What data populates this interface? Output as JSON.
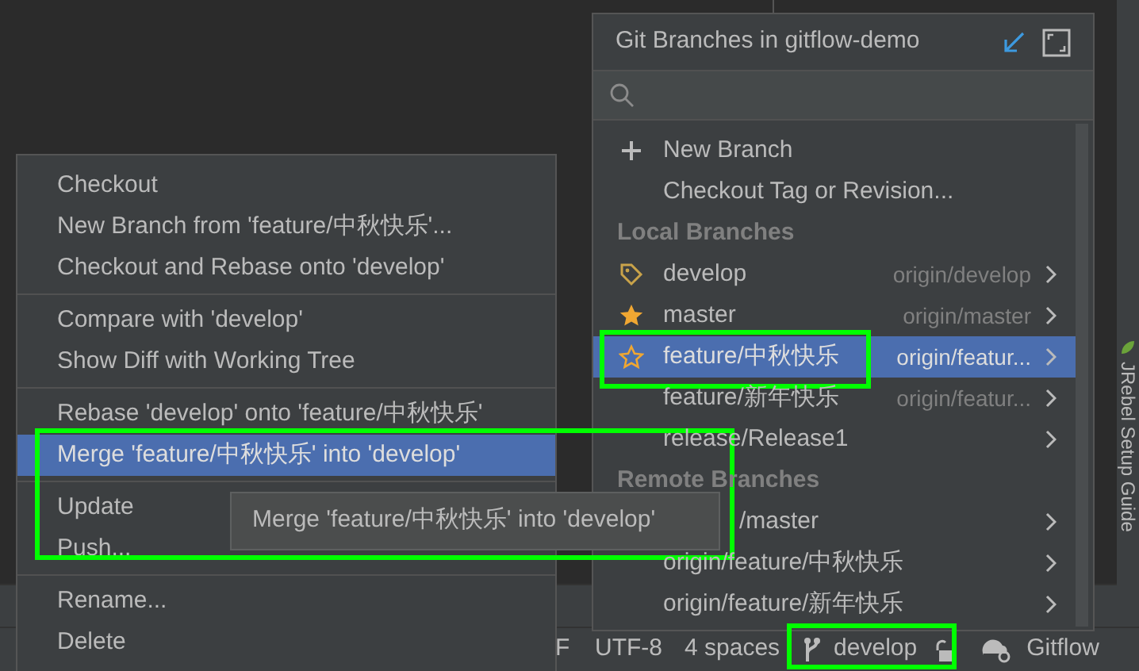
{
  "branches_popup": {
    "title": "Git Branches in gitflow-demo",
    "actions": [
      {
        "kind": "plus",
        "label": "New Branch"
      },
      {
        "kind": "plain",
        "label": "Checkout Tag or Revision..."
      }
    ],
    "local_header": "Local Branches",
    "local": [
      {
        "name": "develop",
        "remote": "origin/develop",
        "kind": "tag",
        "selected": false
      },
      {
        "name": "master",
        "remote": "origin/master",
        "kind": "star",
        "selected": false
      },
      {
        "name": "feature/中秋快乐",
        "remote": "origin/featur...",
        "kind": "star-outline",
        "selected": true
      },
      {
        "name": "feature/新年快乐",
        "remote": "origin/featur...",
        "kind": "plain",
        "selected": false
      },
      {
        "name": "release/Release1",
        "kind": "plain",
        "selected": false
      }
    ],
    "remote_header": "Remote Branches",
    "remote": [
      {
        "name": "/master",
        "partly_covered": true
      },
      {
        "name": "origin/feature/中秋快乐"
      },
      {
        "name": "origin/feature/新年快乐"
      }
    ]
  },
  "context_menu": {
    "groups": [
      [
        {
          "label": "Checkout",
          "selected": false
        },
        {
          "label": "New Branch from 'feature/中秋快乐'...",
          "selected": false
        },
        {
          "label": "Checkout and Rebase onto 'develop'",
          "selected": false
        }
      ],
      [
        {
          "label": "Compare with 'develop'",
          "selected": false
        },
        {
          "label": "Show Diff with Working Tree",
          "selected": false
        }
      ],
      [
        {
          "label": "Rebase 'develop' onto 'feature/中秋快乐'",
          "selected": false
        },
        {
          "label": "Merge 'feature/中秋快乐' into 'develop'",
          "selected": true
        }
      ],
      [
        {
          "label": "Update",
          "selected": false
        },
        {
          "label": "Push...",
          "selected": false
        }
      ],
      [
        {
          "label": "Rename...",
          "selected": false
        },
        {
          "label": "Delete",
          "selected": false
        }
      ]
    ]
  },
  "tooltip": "Merge 'feature/中秋快乐' into 'develop'",
  "side_tab": "JRebel Setup Guide",
  "status_bar": {
    "line_separator": "F",
    "encoding": "UTF-8",
    "indent": "4 spaces",
    "branch": "develop",
    "app": "Gitflow"
  }
}
